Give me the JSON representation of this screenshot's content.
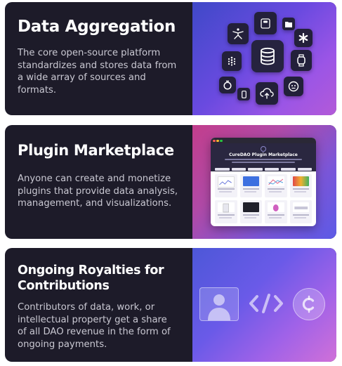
{
  "cards": [
    {
      "title": "Data Aggregation",
      "description": "The core open-source platform standardizes and stores data from a wide array of sources and formats."
    },
    {
      "title": "Plugin Marketplace",
      "description": "Anyone can create and monetize plugins that provide data analysis, management, and visualizations.",
      "mockup": {
        "title": "CureDAO Plugin Marketplace"
      }
    },
    {
      "title": "Ongoing Royalties for Contributions",
      "description": "Contributors of data, work, or intellectual property get a share of all DAO revenue in the form of ongoing payments."
    }
  ],
  "icons": {
    "aggregation": [
      "yoga-person-icon",
      "scale-icon",
      "folder-icon",
      "asterisk-icon",
      "fitbit-icon",
      "database-icon",
      "watch-icon",
      "stopwatch-icon",
      "phone-icon",
      "cloud-upload-icon",
      "sensor-icon"
    ],
    "royalties": [
      "person-avatar-icon",
      "code-icon",
      "currency-coin-icon"
    ]
  },
  "colors": {
    "card_bg": "#1d1b29",
    "title": "#ffffff",
    "description": "#c9c8d2"
  }
}
